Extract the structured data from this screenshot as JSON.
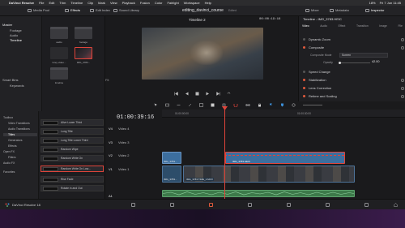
{
  "menubar": {
    "apple": "",
    "app": "DaVinci Resolve",
    "items": [
      "File",
      "Edit",
      "Trim",
      "Timeline",
      "Clip",
      "Mark",
      "View",
      "Playback",
      "Fusion",
      "Color",
      "Fairlight",
      "Workspace",
      "Help"
    ],
    "status": "18%",
    "clock": "Fri 7 Jun 11:45"
  },
  "toolbar": {
    "media_pool": "Media Pool",
    "effects": "Effects",
    "edit_index": "Edit Index",
    "sound_library": "Sound Library",
    "project_title": "editing_davinci_course",
    "project_status": "Edited",
    "mixer": "Mixer",
    "metadata": "Metadata",
    "inspector": "Inspector"
  },
  "bins": {
    "header": "Master",
    "items": [
      "Footage",
      "Audio",
      "Timeline"
    ],
    "smart_bins_label": "Smart Bins",
    "smart_bins_items": [
      "Keywords"
    ]
  },
  "media_pool": {
    "clips": [
      {
        "label": "audio",
        "kind": "folder"
      },
      {
        "label": "footage",
        "kind": "folder"
      },
      {
        "label": "Grey video...",
        "kind": "clip"
      },
      {
        "label": "IMG_3783...",
        "kind": "clip"
      },
      {
        "label": "timeline",
        "kind": "folder"
      }
    ]
  },
  "viewer": {
    "timeline_name": "Timeline 2",
    "timecode": "00:00:19:16",
    "zoom": "Fit"
  },
  "inspector": {
    "title": "Timeline - IMG_3783.HEIC",
    "tabs": [
      "Video",
      "Audio",
      "Effect",
      "Transition",
      "Image",
      "File"
    ],
    "sections": [
      "Dynamic Zoom",
      "Composite",
      "Speed Change",
      "Stabilization",
      "Lens Correction",
      "Retime and Scaling"
    ],
    "composite_mode_label": "Composite Mode",
    "composite_mode_value": "Screen",
    "opacity_label": "Opacity",
    "opacity_value": "42.00"
  },
  "effects": {
    "tree": [
      "Toolbox",
      "Video Transitions",
      "Audio Transitions",
      "Titles",
      "Generators",
      "Effects",
      "Open FX",
      "Filters",
      "Audio FX"
    ],
    "favorites_label": "Favorites",
    "list": [
      "Alive Lower Third",
      "Long Title",
      "Long Title Lower Third",
      "Random Wipe",
      "Random Write On",
      "Random Write On Low...",
      "Rise Fade",
      "Rotate in and Out"
    ],
    "selected_index": 5
  },
  "timeline": {
    "timecode": "01:00:39:16",
    "ruler_labels": [
      "01:00:00:00",
      "01:00:30:00"
    ],
    "tracks": [
      {
        "id": "V4",
        "name": "Video 4"
      },
      {
        "id": "V3",
        "name": "Video 3"
      },
      {
        "id": "V2",
        "name": "Video 2"
      },
      {
        "id": "V1",
        "name": "Video 1"
      },
      {
        "id": "A1",
        "name": ""
      }
    ],
    "clips": {
      "v2_left": "IMG_3783...",
      "v2_right": "IMG_3783.HEIC",
      "v1_left": "IMG_3783...",
      "v1_main": "IMG_3783 TIME_1.MOV"
    }
  },
  "pagebar": {
    "app_name": "DaVinci Resolve 18"
  },
  "colors": {
    "accent": "#e0443a",
    "clip_blue": "#3c6e9e",
    "audio_green": "#3d7a4a"
  }
}
